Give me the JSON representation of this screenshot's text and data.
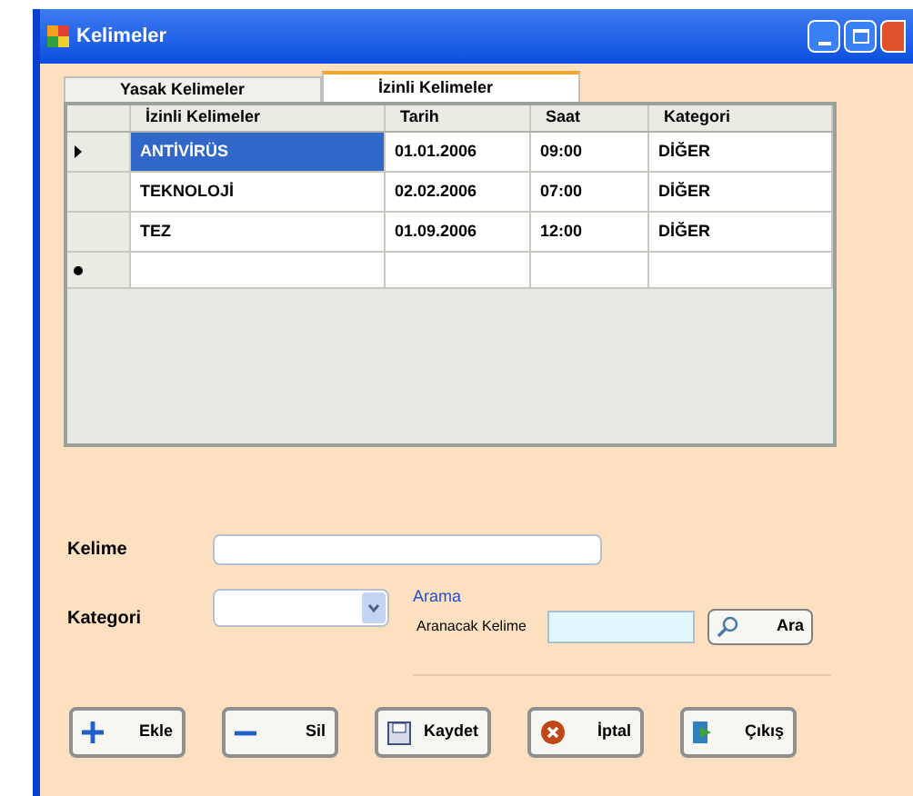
{
  "window": {
    "title": "Kelimeler"
  },
  "tabs": [
    {
      "label": "Yasak Kelimeler",
      "selected": false
    },
    {
      "label": "İzinli Kelimeler",
      "selected": true
    }
  ],
  "table": {
    "columns": [
      "İzinli Kelimeler",
      "Tarih",
      "Saat",
      "Kategori"
    ],
    "rows": [
      {
        "cells": [
          "ANTİVİRÜS",
          "01.01.2006",
          "09:00",
          "DİĞER"
        ],
        "selected": true
      },
      {
        "cells": [
          "TEKNOLOJİ",
          "02.02.2006",
          "07:00",
          "DİĞER"
        ],
        "selected": false
      },
      {
        "cells": [
          "TEZ",
          "01.09.2006",
          "12:00",
          "DİĞER"
        ],
        "selected": false
      }
    ]
  },
  "form": {
    "word_label": "Kelime",
    "category_label": "Kategori"
  },
  "search": {
    "group_label": "Arama",
    "field_label": "Aranacak Kelime",
    "button": "Ara"
  },
  "buttons": [
    {
      "kind": "add",
      "label": "Ekle"
    },
    {
      "kind": "remove",
      "label": "Sil"
    },
    {
      "kind": "save",
      "label": "Kaydet"
    },
    {
      "kind": "cancel",
      "label": "İptal"
    },
    {
      "kind": "exit",
      "label": "Çıkış"
    }
  ]
}
